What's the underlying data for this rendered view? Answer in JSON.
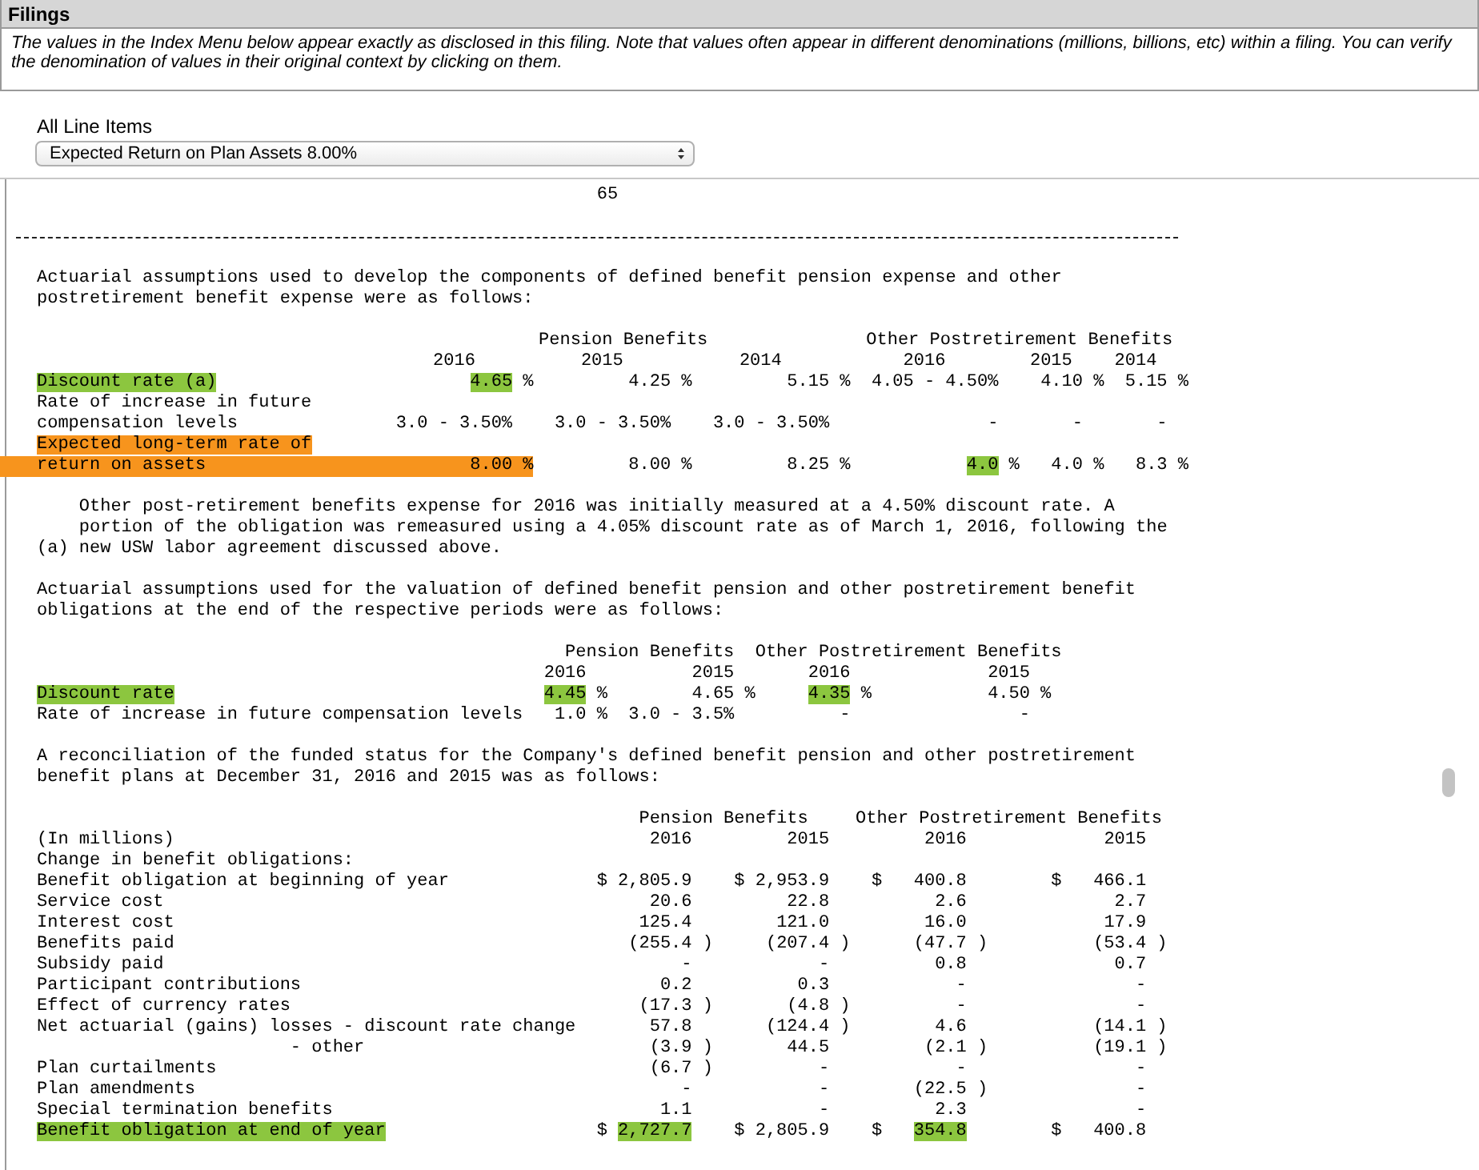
{
  "panel": {
    "title": "Filings",
    "notice": "The values in the Index Menu below appear exactly as disclosed in this filing. Note that values often appear in different denominations (millions, billions, etc) within a filing. You can verify the denomination of values in their original context by clicking on them."
  },
  "line_items": {
    "label": "All Line Items",
    "value": "Expected Return on Plan Assets 8.00%"
  },
  "document": {
    "page_number": "65",
    "blocks": [
      {
        "kind": "rule"
      },
      {
        "kind": "paragraph",
        "lines": [
          "Actuarial assumptions used to develop the components of defined benefit pension expense and other",
          "postretirement benefit expense were as follows:"
        ]
      },
      {
        "kind": "table",
        "rows": [
          {
            "kind": "group_header",
            "groups": [
              "Pension Benefits",
              "Other Postretirement Benefits"
            ]
          },
          {
            "kind": "years",
            "years": [
              "2016",
              "2015",
              "2014",
              "2016",
              "2015",
              "2014"
            ]
          },
          {
            "kind": "data",
            "label": "Discount rate (a)",
            "highlighted": true,
            "selected": false,
            "cells": [
              {
                "value": "4.65",
                "suffix": "%",
                "highlighted": true,
                "selected": false
              },
              {
                "value": "4.25",
                "suffix": "%",
                "highlighted": false,
                "selected": false
              },
              {
                "value": "5.15",
                "suffix": "%",
                "highlighted": false,
                "selected": false
              },
              {
                "value": "4.05 - 4.50%",
                "highlighted": false,
                "selected": false
              },
              {
                "value": "4.10",
                "suffix": "%",
                "highlighted": false,
                "selected": false
              },
              {
                "value": "5.15",
                "suffix": "%",
                "highlighted": false,
                "selected": false
              }
            ]
          },
          {
            "kind": "data",
            "label": "Rate of increase in future",
            "highlighted": false,
            "selected": false
          },
          {
            "kind": "data",
            "label": "compensation levels",
            "highlighted": false,
            "selected": false,
            "cells": [
              {
                "value": "3.0 - 3.50%",
                "highlighted": false,
                "selected": false
              },
              {
                "value": "3.0 - 3.50%",
                "highlighted": false,
                "selected": false
              },
              {
                "value": "3.0 - 3.50%",
                "highlighted": false,
                "selected": false
              },
              {
                "value": "-",
                "highlighted": false,
                "selected": false
              },
              {
                "value": "-",
                "highlighted": false,
                "selected": false
              },
              {
                "value": "-",
                "highlighted": false,
                "selected": false
              }
            ]
          },
          {
            "kind": "data",
            "label": "Expected long-term rate of",
            "highlighted": false,
            "selected": true
          },
          {
            "kind": "data",
            "label": "return on assets",
            "highlighted": false,
            "selected": true,
            "cells": [
              {
                "value": "8.00",
                "suffix": "%",
                "highlighted": false,
                "selected": true
              },
              {
                "value": "8.00",
                "suffix": "%",
                "highlighted": false,
                "selected": false
              },
              {
                "value": "8.25",
                "suffix": "%",
                "highlighted": false,
                "selected": false
              },
              {
                "value": "4.0",
                "suffix": "%",
                "highlighted": true,
                "selected": false
              },
              {
                "value": "4.0",
                "suffix": "%",
                "highlighted": false,
                "selected": false
              },
              {
                "value": "8.3",
                "suffix": "%",
                "highlighted": false,
                "selected": false
              }
            ]
          }
        ]
      },
      {
        "kind": "footnote",
        "marker": "(a)",
        "lines": [
          "Other post-retirement benefits expense for 2016 was initially measured at a 4.50% discount rate. A",
          "portion of the obligation was remeasured using a 4.05% discount rate as of March 1, 2016, following the",
          "new USW labor agreement discussed above."
        ]
      },
      {
        "kind": "paragraph",
        "lines": [
          "Actuarial assumptions used for the valuation of defined benefit pension and other postretirement benefit",
          "obligations at the end of the respective periods were as follows:"
        ]
      },
      {
        "kind": "table",
        "rows": [
          {
            "kind": "group_header",
            "groups": [
              "Pension Benefits",
              "Other Postretirement Benefits"
            ]
          },
          {
            "kind": "years",
            "years": [
              "2016",
              "2015",
              "2016",
              "2015"
            ]
          },
          {
            "kind": "data",
            "label": "Discount rate",
            "highlighted": true,
            "selected": false,
            "cells": [
              {
                "value": "4.45",
                "suffix": "%",
                "highlighted": true,
                "selected": false
              },
              {
                "value": "4.65",
                "suffix": "%",
                "highlighted": false,
                "selected": false
              },
              {
                "value": "4.35",
                "suffix": "%",
                "highlighted": true,
                "selected": false
              },
              {
                "value": "4.50",
                "suffix": "%",
                "highlighted": false,
                "selected": false
              }
            ]
          },
          {
            "kind": "data",
            "label": "Rate of increase in future compensation levels",
            "highlighted": false,
            "selected": false,
            "cells": [
              {
                "value": "1.0",
                "suffix": "%",
                "highlighted": false,
                "selected": false
              },
              {
                "value": "3.0 - 3.5%",
                "highlighted": false,
                "selected": false
              },
              {
                "value": "-",
                "highlighted": false,
                "selected": false
              },
              {
                "value": "-",
                "highlighted": false,
                "selected": false
              }
            ]
          }
        ]
      },
      {
        "kind": "paragraph",
        "lines": [
          "A reconciliation of the funded status for the Company's defined benefit pension and other postretirement",
          "benefit plans at December 31, 2016 and 2015 was as follows:"
        ]
      },
      {
        "kind": "table",
        "rows": [
          {
            "kind": "group_header",
            "groups": [
              "Pension Benefits",
              "Other Postretirement Benefits"
            ]
          },
          {
            "kind": "years",
            "label": "(In millions)",
            "years": [
              "2016",
              "2015",
              "2016",
              "2015"
            ]
          },
          {
            "kind": "data",
            "label": "Change in benefit obligations:",
            "highlighted": false,
            "selected": false
          },
          {
            "kind": "data",
            "label": "Benefit obligation at beginning of year",
            "highlighted": false,
            "selected": false,
            "cells": [
              {
                "prefix": "$",
                "value": "2,805.9",
                "highlighted": false,
                "selected": false
              },
              {
                "prefix": "$",
                "value": "2,953.9",
                "highlighted": false,
                "selected": false
              },
              {
                "prefix": "$",
                "value": "400.8",
                "highlighted": false,
                "selected": false
              },
              {
                "prefix": "$",
                "value": "466.1",
                "highlighted": false,
                "selected": false
              }
            ]
          },
          {
            "kind": "data",
            "label": "Service cost",
            "highlighted": false,
            "selected": false,
            "cells": [
              {
                "value": "20.6",
                "highlighted": false,
                "selected": false
              },
              {
                "value": "22.8",
                "highlighted": false,
                "selected": false
              },
              {
                "value": "2.6",
                "highlighted": false,
                "selected": false
              },
              {
                "value": "2.7",
                "highlighted": false,
                "selected": false
              }
            ]
          },
          {
            "kind": "data",
            "label": "Interest cost",
            "highlighted": false,
            "selected": false,
            "cells": [
              {
                "value": "125.4",
                "highlighted": false,
                "selected": false
              },
              {
                "value": "121.0",
                "highlighted": false,
                "selected": false
              },
              {
                "value": "16.0",
                "highlighted": false,
                "selected": false
              },
              {
                "value": "17.9",
                "highlighted": false,
                "selected": false
              }
            ]
          },
          {
            "kind": "data",
            "label": "Benefits paid",
            "highlighted": false,
            "selected": false,
            "cells": [
              {
                "value": "(255.4",
                "suffix": ")",
                "highlighted": false,
                "selected": false
              },
              {
                "value": "(207.4",
                "suffix": ")",
                "highlighted": false,
                "selected": false
              },
              {
                "value": "(47.7",
                "suffix": ")",
                "highlighted": false,
                "selected": false
              },
              {
                "value": "(53.4",
                "suffix": ")",
                "highlighted": false,
                "selected": false
              }
            ]
          },
          {
            "kind": "data",
            "label": "Subsidy paid",
            "highlighted": false,
            "selected": false,
            "cells": [
              {
                "value": "-",
                "highlighted": false,
                "selected": false
              },
              {
                "value": "-",
                "highlighted": false,
                "selected": false
              },
              {
                "value": "0.8",
                "highlighted": false,
                "selected": false
              },
              {
                "value": "0.7",
                "highlighted": false,
                "selected": false
              }
            ]
          },
          {
            "kind": "data",
            "label": "Participant contributions",
            "highlighted": false,
            "selected": false,
            "cells": [
              {
                "value": "0.2",
                "highlighted": false,
                "selected": false
              },
              {
                "value": "0.3",
                "highlighted": false,
                "selected": false
              },
              {
                "value": "-",
                "highlighted": false,
                "selected": false
              },
              {
                "value": "-",
                "highlighted": false,
                "selected": false
              }
            ]
          },
          {
            "kind": "data",
            "label": "Effect of currency rates",
            "highlighted": false,
            "selected": false,
            "cells": [
              {
                "value": "(17.3",
                "suffix": ")",
                "highlighted": false,
                "selected": false
              },
              {
                "value": "(4.8",
                "suffix": ")",
                "highlighted": false,
                "selected": false
              },
              {
                "value": "-",
                "highlighted": false,
                "selected": false
              },
              {
                "value": "-",
                "highlighted": false,
                "selected": false
              }
            ]
          },
          {
            "kind": "data",
            "label": "Net actuarial (gains) losses - discount rate change",
            "highlighted": false,
            "selected": false,
            "cells": [
              {
                "value": "57.8",
                "highlighted": false,
                "selected": false
              },
              {
                "value": "(124.4",
                "suffix": ")",
                "highlighted": false,
                "selected": false
              },
              {
                "value": "4.6",
                "highlighted": false,
                "selected": false
              },
              {
                "value": "(14.1",
                "suffix": ")",
                "highlighted": false,
                "selected": false
              }
            ],
            "children": [
              {
                "kind": "data",
                "label": "- other",
                "highlighted": false,
                "selected": false,
                "cells": [
                  {
                    "value": "(3.9",
                    "suffix": ")",
                    "highlighted": false,
                    "selected": false
                  },
                  {
                    "value": "44.5",
                    "highlighted": false,
                    "selected": false
                  },
                  {
                    "value": "(2.1",
                    "suffix": ")",
                    "highlighted": false,
                    "selected": false
                  },
                  {
                    "value": "(19.1",
                    "suffix": ")",
                    "highlighted": false,
                    "selected": false
                  }
                ]
              }
            ]
          },
          {
            "kind": "data",
            "label": "Plan curtailments",
            "highlighted": false,
            "selected": false,
            "cells": [
              {
                "value": "(6.7",
                "suffix": ")",
                "highlighted": false,
                "selected": false
              },
              {
                "value": "-",
                "highlighted": false,
                "selected": false
              },
              {
                "value": "-",
                "highlighted": false,
                "selected": false
              },
              {
                "value": "-",
                "highlighted": false,
                "selected": false
              }
            ]
          },
          {
            "kind": "data",
            "label": "Plan amendments",
            "highlighted": false,
            "selected": false,
            "cells": [
              {
                "value": "-",
                "highlighted": false,
                "selected": false
              },
              {
                "value": "-",
                "highlighted": false,
                "selected": false
              },
              {
                "value": "(22.5",
                "suffix": ")",
                "highlighted": false,
                "selected": false
              },
              {
                "value": "-",
                "highlighted": false,
                "selected": false
              }
            ]
          },
          {
            "kind": "data",
            "label": "Special termination benefits",
            "highlighted": false,
            "selected": false,
            "cells": [
              {
                "value": "1.1",
                "highlighted": false,
                "selected": false
              },
              {
                "value": "-",
                "highlighted": false,
                "selected": false
              },
              {
                "value": "2.3",
                "highlighted": false,
                "selected": false
              },
              {
                "value": "-",
                "highlighted": false,
                "selected": false
              }
            ]
          },
          {
            "kind": "data",
            "label": "Benefit obligation at end of year",
            "highlighted": true,
            "selected": false,
            "cells": [
              {
                "prefix": "$",
                "value": "2,727.7",
                "highlighted": true,
                "selected": false
              },
              {
                "prefix": "$",
                "value": "2,805.9",
                "highlighted": false,
                "selected": false
              },
              {
                "prefix": "$",
                "value": "354.8",
                "highlighted": true,
                "selected": false
              },
              {
                "prefix": "$",
                "value": "400.8",
                "highlighted": false,
                "selected": false
              }
            ]
          }
        ]
      }
    ]
  }
}
